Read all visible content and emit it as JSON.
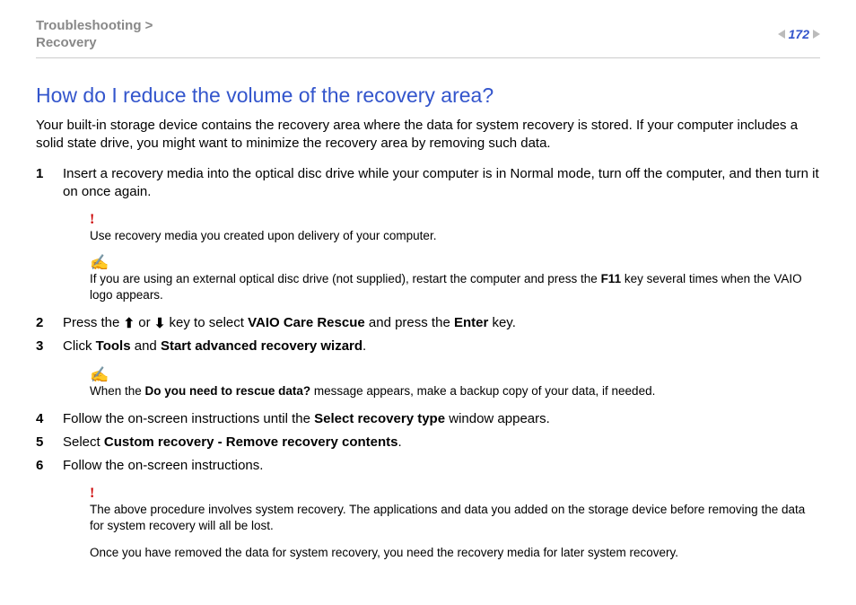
{
  "breadcrumb": {
    "line1": "Troubleshooting >",
    "line2": "Recovery"
  },
  "page_number": "172",
  "title": "How do I reduce the volume of the recovery area?",
  "intro": "Your built-in storage device contains the recovery area where the data for system recovery is stored. If your computer includes a solid state drive, you might want to minimize the recovery area by removing such data.",
  "steps": {
    "s1": {
      "num": "1",
      "text": "Insert a recovery media into the optical disc drive while your computer is in Normal mode, turn off the computer, and then turn it on once again."
    },
    "s2": {
      "num": "2",
      "pre": "Press the ",
      "mid": " or ",
      "post": " key to select ",
      "bold1": "VAIO Care Rescue",
      "mid2": " and press the ",
      "bold2": "Enter",
      "end": " key."
    },
    "s3": {
      "num": "3",
      "pre": "Click ",
      "bold1": "Tools",
      "mid": " and ",
      "bold2": "Start advanced recovery wizard",
      "end": "."
    },
    "s4": {
      "num": "4",
      "pre": "Follow the on-screen instructions until the ",
      "bold1": "Select recovery type",
      "end": " window appears."
    },
    "s5": {
      "num": "5",
      "pre": "Select ",
      "bold1": "Custom recovery - Remove recovery contents",
      "end": "."
    },
    "s6": {
      "num": "6",
      "text": "Follow the on-screen instructions."
    }
  },
  "notes": {
    "n1": {
      "mark": "!",
      "text": "Use recovery media you created upon delivery of your computer."
    },
    "n2": {
      "mark": "✍",
      "pre": "If you are using an external optical disc drive (not supplied), restart the computer and press the ",
      "bold1": "F11",
      "end": " key several times when the VAIO logo appears."
    },
    "n3": {
      "mark": "✍",
      "pre": "When the ",
      "bold1": "Do you need to rescue data?",
      "end": " message appears, make a backup copy of your data, if needed."
    },
    "n4": {
      "mark": "!",
      "text": "The above procedure involves system recovery. The applications and data you added on the storage device before removing the data for system recovery will all be lost."
    },
    "n5": {
      "text": "Once you have removed the data for system recovery, you need the recovery media for later system recovery."
    }
  },
  "icons": {
    "up": "⬆",
    "down": "⬇"
  }
}
